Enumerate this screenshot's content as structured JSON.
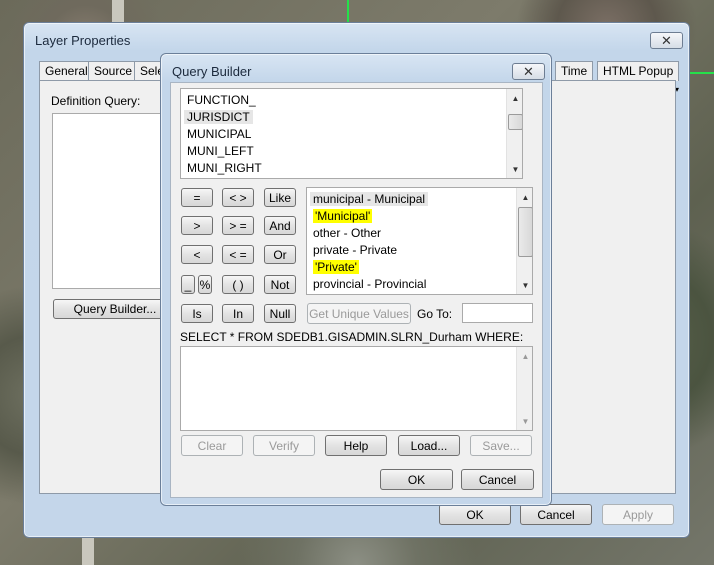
{
  "layer_props": {
    "title": "Layer Properties",
    "tabs": [
      "General",
      "Source",
      "Sele",
      "Time",
      "HTML Popup"
    ],
    "definition_query_label": "Definition Query:",
    "query_builder_button": "Query Builder...",
    "ok": "OK",
    "cancel": "Cancel",
    "apply": "Apply"
  },
  "qb": {
    "title": "Query Builder",
    "fields": [
      "FUNCTION_",
      "JURISDICT",
      "MUNICIPAL",
      "MUNI_LEFT",
      "MUNI_RIGHT"
    ],
    "selected_field": "JURISDICT",
    "operators": {
      "eq": "=",
      "ne": "< >",
      "like": "Like",
      "gt": ">",
      "ge": "> =",
      "and": "And",
      "lt": "<",
      "le": "< =",
      "or": "Or",
      "underscore": "_",
      "percent": "%",
      "parens": "( )",
      "not": "Not",
      "is": "Is",
      "in": "In",
      "null": "Null"
    },
    "values": [
      "municipal - Municipal",
      "'Municipal'",
      "other - Other",
      "private - Private",
      "'Private'",
      "provincial - Provincial"
    ],
    "get_unique_values": "Get Unique Values",
    "go_to_label": "Go To:",
    "go_to_value": "",
    "sql_prefix": "SELECT * FROM SDEDB1.GISADMIN.SLRN_Durham WHERE:",
    "sql_text": "",
    "clear": "Clear",
    "verify": "Verify",
    "help": "Help",
    "load": "Load...",
    "save": "Save...",
    "ok": "OK",
    "cancel": "Cancel"
  },
  "icons": {
    "close": "close-icon",
    "up": "arrow-up-icon",
    "down": "arrow-down-icon"
  }
}
